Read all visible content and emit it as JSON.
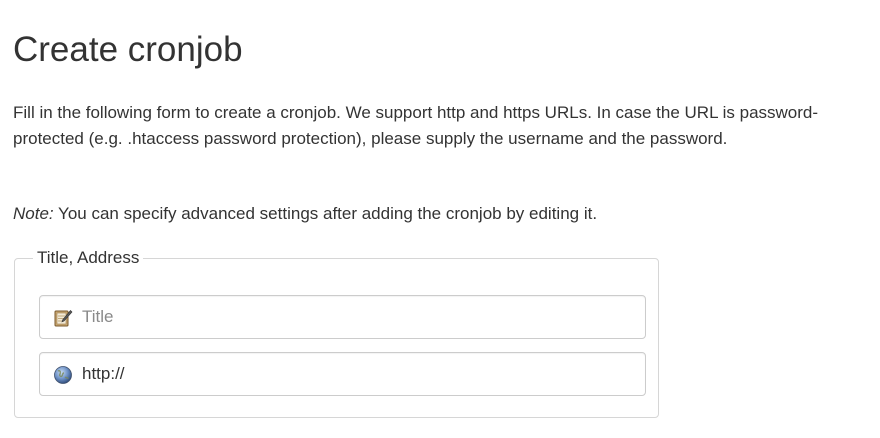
{
  "page": {
    "title": "Create cronjob",
    "intro": "Fill in the following form to create a cronjob. We support http and https URLs. In case the URL is password-protected (e.g. .htaccess password protection), please supply the username and the password.",
    "note_label": "Note:",
    "note_text": " You can specify advanced settings after adding the cronjob by editing it."
  },
  "form": {
    "legend": "Title, Address",
    "title_field": {
      "icon": "notepad-icon",
      "placeholder": "Title",
      "value": ""
    },
    "url_field": {
      "icon": "globe-icon",
      "placeholder": "",
      "value": "http://"
    }
  }
}
